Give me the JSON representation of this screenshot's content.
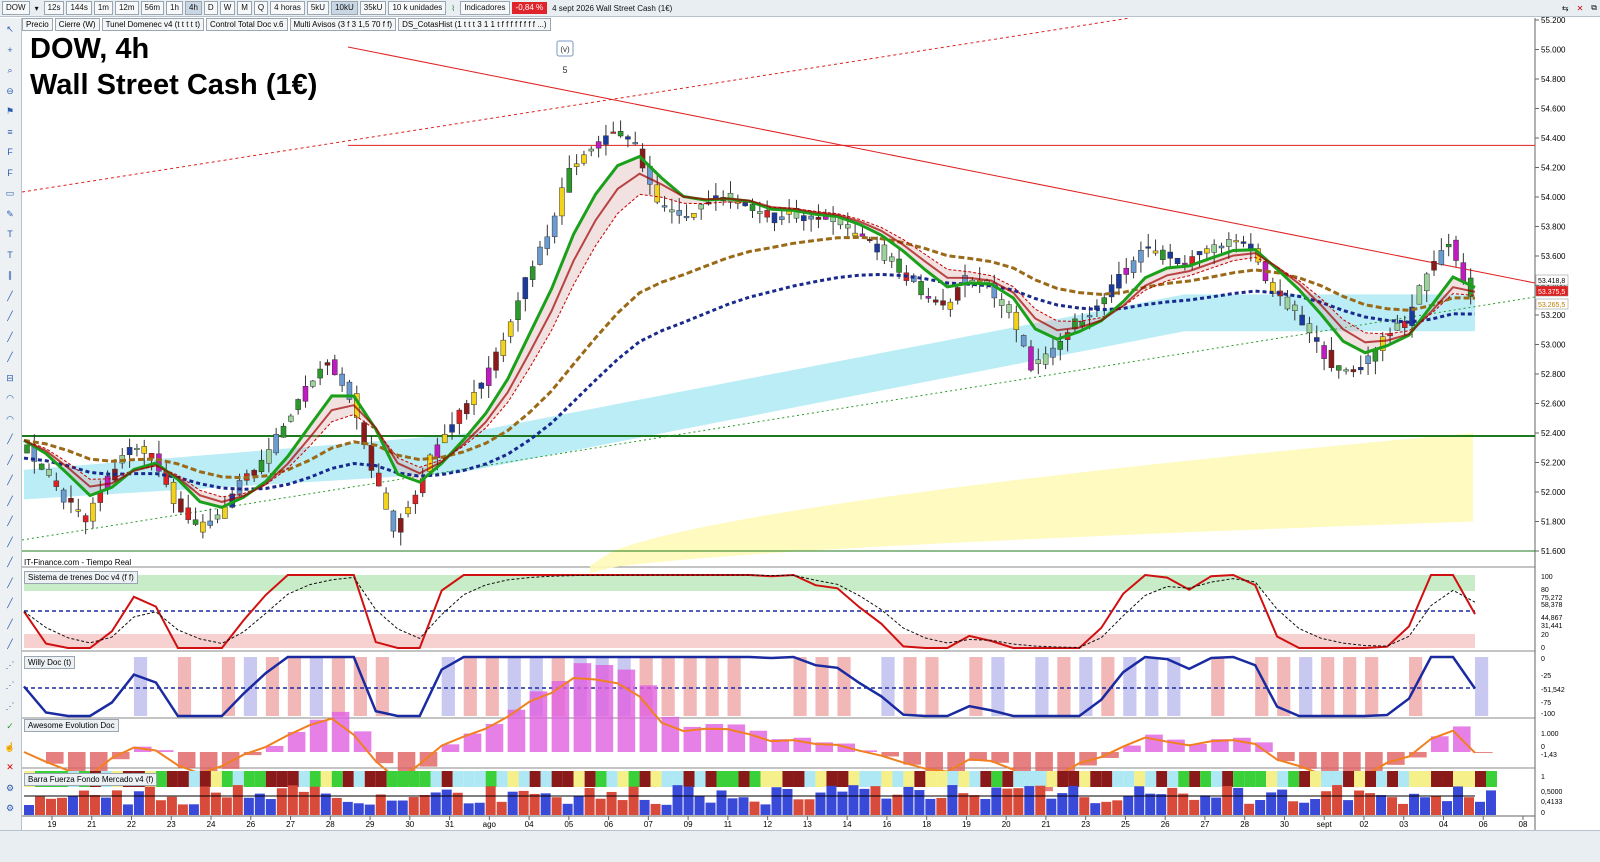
{
  "toolbar": {
    "symbol": "DOW",
    "timeframes": [
      "12s",
      "144s",
      "1m",
      "12m",
      "56m",
      "1h",
      "4h",
      "D",
      "W",
      "M",
      "Q"
    ],
    "active_timeframe": "4h",
    "period": "4 horas",
    "unit_buttons": [
      "5kU",
      "10kU",
      "35kU"
    ],
    "active_unit": "10kU",
    "units": "10 k unidades",
    "indicators": "Indicadores",
    "change": "-0,84 %",
    "description": "4 sept 2026  Wall Street Cash (1€)",
    "colors": {
      "negative": "#e0242c"
    }
  },
  "indicator_tags": [
    "Precio",
    "Cierre (W)",
    "Tunel Domenec v4 (t t t t t)",
    "Control Total Doc v.6",
    "Multi Avisos (3 f 3 1,5 70 f f)",
    "DS_CotasHist (1 t t t 3 1 1 t f f f f f f f f ...)"
  ],
  "chart_title": "DOW, 4h",
  "chart_subtitle": "Wall Street Cash (1€)",
  "source": "IT-Finance.com - Tiempo Real",
  "wave_marker": "(v)",
  "wave_number": "5",
  "panes": {
    "trains": "Sistema de trenes Doc v4 (f f)",
    "willy": "Willy Doc (t)",
    "awesome": "Awesome Evolution Doc",
    "barra": "Barra Fuerza Fondo Mercado v4 (f)"
  },
  "left_tool_icons": [
    "cursor-icon",
    "crosshair-icon",
    "zoom-icon",
    "zoom-out-icon",
    "alert-icon",
    "layers-icon",
    "fibonacci-icon",
    "fibonacci-icon",
    "rectangle-icon",
    "pencil-icon",
    "text-icon",
    "text-icon",
    "channel-icon",
    "line-icon",
    "line-icon",
    "line-icon",
    "line-icon",
    "ruler-icon",
    "arc-icon",
    "arc-icon",
    "line-icon",
    "line-icon",
    "line-icon",
    "line-icon",
    "line-icon",
    "line-icon",
    "line-icon",
    "line-icon",
    "line-icon",
    "line-icon",
    "line-icon",
    "pattern-icon",
    "pattern-icon",
    "pattern-icon",
    "check-icon",
    "thumb-icon",
    "delete-icon",
    "settings-icon",
    "settings-icon"
  ],
  "chart_data": [
    {
      "type": "candlestick",
      "ylim": [
        51400,
        55200
      ],
      "y_ticks": [
        "55.200",
        "55.000",
        "54.800",
        "54.600",
        "54.400",
        "54.200",
        "54.000",
        "53.800",
        "53.600",
        "53.400",
        "53.200",
        "53.000",
        "52.800",
        "52.600",
        "52.400",
        "52.200",
        "52.000",
        "51.800",
        "51.600"
      ],
      "x_ticks": [
        "19",
        "21",
        "22",
        "23",
        "24",
        "26",
        "27",
        "28",
        "29",
        "30",
        "31",
        "ago",
        "04",
        "05",
        "06",
        "07",
        "09",
        "11",
        "12",
        "13",
        "14",
        "16",
        "18",
        "19",
        "20",
        "21",
        "23",
        "25",
        "26",
        "27",
        "28",
        "30",
        "sept",
        "02",
        "03",
        "04",
        "06",
        "08"
      ],
      "price_labels": [
        "53.418,8",
        "53.375,5",
        "53.265,5"
      ],
      "horizontal_lines": [
        54350,
        52380,
        51600
      ],
      "close_path": [
        52350,
        52150,
        51950,
        51800,
        52100,
        52300,
        52250,
        51950,
        51750,
        51850,
        52050,
        52200,
        52450,
        52700,
        52900,
        52650,
        52150,
        51750,
        52000,
        52350,
        52550,
        52750,
        53050,
        53450,
        53750,
        54200,
        54350,
        54450,
        54350,
        53950,
        53850,
        53950,
        54000,
        53950,
        53850,
        53900,
        53850,
        53850,
        53750,
        53650,
        53500,
        53350,
        53250,
        53450,
        53400,
        53200,
        52850,
        52950,
        53150,
        53250,
        53450,
        53650,
        53600,
        53550,
        53650,
        53700,
        53650,
        53350,
        53200,
        53000,
        52800,
        52850,
        53050,
        53150,
        53500,
        53700,
        53300
      ],
      "series": [
        {
          "name": "",
          "color": "#1aa01a",
          "role": "fast-ma"
        },
        {
          "name": "",
          "color": "#c40000",
          "role": "slow-ma"
        },
        {
          "name": "",
          "color": "#1a2a8c",
          "role": "dotted-trend"
        },
        {
          "name": "",
          "color": "#9a6a18",
          "role": "dashed-ma"
        }
      ]
    },
    {
      "type": "line",
      "name": "Sistema de trenes Doc v4 (f f)",
      "y_ticks": [
        "100",
        "80",
        "75,272",
        "58,378",
        "44,867",
        "31,441",
        "20",
        "0"
      ],
      "ylim": [
        0,
        100
      ]
    },
    {
      "type": "line",
      "name": "Willy Doc (t)",
      "y_ticks": [
        "0",
        "-25",
        "-51,542",
        "-75",
        "-100"
      ],
      "ylim": [
        -100,
        0
      ]
    },
    {
      "type": "area",
      "name": "Awesome Evolution Doc",
      "y_ticks": [
        "1.000",
        "0",
        "-1,43"
      ],
      "ylim": [
        -1,
        1
      ]
    },
    {
      "type": "bar",
      "name": "Barra Fuerza Fondo Mercado v4 (f)",
      "y_ticks": [
        "1",
        "0,5000",
        "0,4133",
        "0"
      ],
      "ylim": [
        0,
        1
      ]
    }
  ]
}
